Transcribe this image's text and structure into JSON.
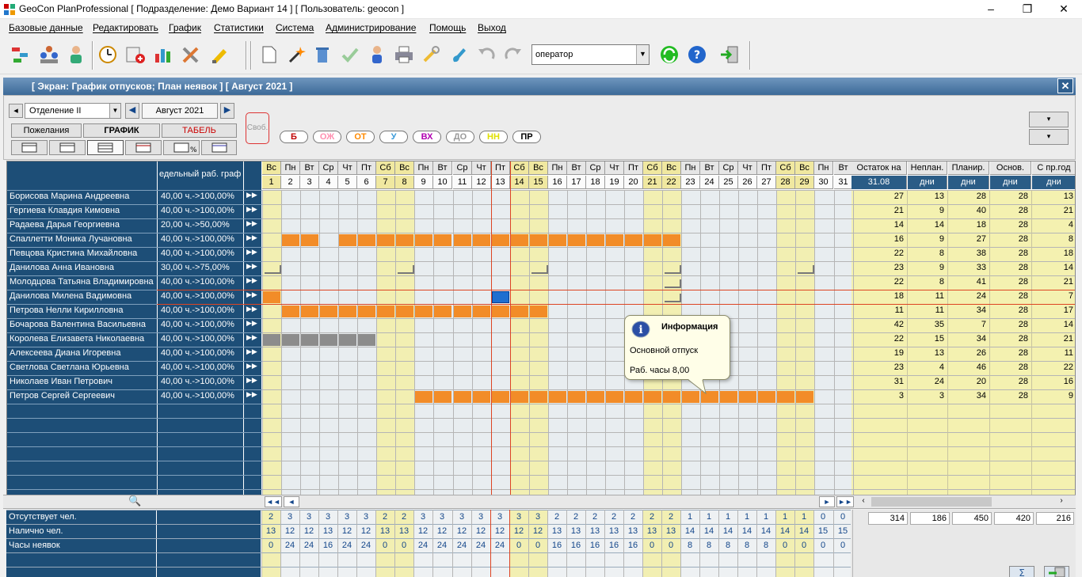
{
  "title": "GeoCon PlanProfessional [ Подразделение: Демо Вариант 14 ] [ Пользователь: geocon ]",
  "menu": [
    "Базовые данные",
    "Редактировать",
    "График",
    "Статистики",
    "Система",
    "Администрирование",
    "Помощь",
    "Выход"
  ],
  "toolbar": {
    "operator": "оператор"
  },
  "window_title": "[ Экран: График отпусков; План неявок ] [ Август 2021 ]",
  "controls": {
    "department": "Отделение II",
    "month": "Август 2021",
    "tabs": [
      "Пожелания",
      "ГРАФИК",
      "ТАБЕЛЬ"
    ],
    "free_label": "Своб.",
    "legend": [
      {
        "code": "Б",
        "color": "#c00000"
      },
      {
        "code": "ОЖ",
        "color": "#ff8fb0"
      },
      {
        "code": "ОТ",
        "color": "#ff8a00"
      },
      {
        "code": "У",
        "color": "#3a9ad9"
      },
      {
        "code": "ВХ",
        "color": "#b000b0"
      },
      {
        "code": "ДО",
        "color": "#9a9a9a"
      },
      {
        "code": "НН",
        "color": "#e0e000"
      },
      {
        "code": "ПР",
        "color": "#000000"
      }
    ]
  },
  "grid": {
    "norm_header": "едельный раб. графи",
    "weekdays": [
      "Вс",
      "Пн",
      "Вт",
      "Ср",
      "Чт",
      "Пт",
      "Сб",
      "Вс",
      "Пн",
      "Вт",
      "Ср",
      "Чт",
      "Пт",
      "Сб",
      "Вс",
      "Пн",
      "Вт",
      "Ср",
      "Чт",
      "Пт",
      "Сб",
      "Вс",
      "Пн",
      "Вт",
      "Ср",
      "Чт",
      "Пт",
      "Сб",
      "Вс",
      "Пн",
      "Вт"
    ],
    "right_headers": [
      {
        "top": "Остаток на",
        "sub": "31.08"
      },
      {
        "top": "Неплан.",
        "sub": "дни"
      },
      {
        "top": "Планир.",
        "sub": "дни"
      },
      {
        "top": "Основ.",
        "sub": "дни"
      },
      {
        "top": "С пр.год",
        "sub": "дни"
      }
    ],
    "rows": [
      {
        "name": "Борисова Марина Андреевна",
        "norm": "40,00 ч.->100,00%",
        "vals": [
          "27",
          "13",
          "28",
          "28",
          "13"
        ]
      },
      {
        "name": "Гергиева Клавдия Кимовна",
        "norm": "40,00 ч.->100,00%",
        "vals": [
          "21",
          "9",
          "40",
          "28",
          "21"
        ]
      },
      {
        "name": "Радаева Дарья Георгиевна",
        "norm": "20,00 ч.->50,00%",
        "vals": [
          "14",
          "14",
          "18",
          "28",
          "4"
        ]
      },
      {
        "name": "Спаллетти Моника Лучановна",
        "norm": "40,00 ч.->100,00%",
        "vals": [
          "16",
          "9",
          "27",
          "28",
          "8"
        ]
      },
      {
        "name": "Певцова Кристина Михайловна",
        "norm": "40,00 ч.->100,00%",
        "vals": [
          "22",
          "8",
          "38",
          "28",
          "18"
        ]
      },
      {
        "name": "Данилова Анна Ивановна",
        "norm": "30,00 ч.->75,00%",
        "vals": [
          "23",
          "9",
          "33",
          "28",
          "14"
        ]
      },
      {
        "name": "Молодцова Татьяна Владимировна",
        "norm": "40,00 ч.->100,00%",
        "vals": [
          "22",
          "8",
          "41",
          "28",
          "21"
        ]
      },
      {
        "name": "Данилова Милена Вадимовна",
        "norm": "40,00 ч.->100,00%",
        "vals": [
          "18",
          "11",
          "24",
          "28",
          "7"
        ]
      },
      {
        "name": "Петрова Нелли Кирилловна",
        "norm": "40,00 ч.->100,00%",
        "vals": [
          "11",
          "11",
          "34",
          "28",
          "17"
        ]
      },
      {
        "name": "Бочарова Валентина Васильевна",
        "norm": "40,00 ч.->100,00%",
        "vals": [
          "42",
          "35",
          "7",
          "28",
          "14"
        ]
      },
      {
        "name": "Королева Елизавета Николаевна",
        "norm": "40,00 ч.->100,00%",
        "vals": [
          "22",
          "15",
          "34",
          "28",
          "21"
        ]
      },
      {
        "name": "Алексеева Диана Игоревна",
        "norm": "40,00 ч.->100,00%",
        "vals": [
          "19",
          "13",
          "26",
          "28",
          "11"
        ]
      },
      {
        "name": "Светлова Светлана Юрьевна",
        "norm": "40,00 ч.->100,00%",
        "vals": [
          "23",
          "4",
          "46",
          "28",
          "22"
        ]
      },
      {
        "name": "Николаев Иван Петрович",
        "norm": "40,00 ч.->100,00%",
        "vals": [
          "31",
          "24",
          "20",
          "28",
          "16"
        ]
      },
      {
        "name": "Петров Сергей Сергеевич",
        "norm": "40,00 ч.->100,00%",
        "vals": [
          "3",
          "3",
          "34",
          "28",
          "9"
        ]
      }
    ]
  },
  "summary": {
    "rows": [
      {
        "label": "Отсутствует чел.",
        "vals": [
          "2",
          "3",
          "3",
          "3",
          "3",
          "3",
          "2",
          "2",
          "3",
          "3",
          "3",
          "3",
          "3",
          "3",
          "3",
          "2",
          "2",
          "2",
          "2",
          "2",
          "2",
          "2",
          "1",
          "1",
          "1",
          "1",
          "1",
          "1",
          "1",
          "0",
          "0"
        ]
      },
      {
        "label": "Налично чел.",
        "vals": [
          "13",
          "12",
          "12",
          "13",
          "12",
          "12",
          "13",
          "13",
          "12",
          "12",
          "12",
          "12",
          "12",
          "12",
          "12",
          "13",
          "13",
          "13",
          "13",
          "13",
          "13",
          "13",
          "14",
          "14",
          "14",
          "14",
          "14",
          "14",
          "14",
          "15",
          "15"
        ]
      },
      {
        "label": "Часы неявок",
        "vals": [
          "0",
          "24",
          "24",
          "16",
          "24",
          "24",
          "0",
          "0",
          "24",
          "24",
          "24",
          "24",
          "24",
          "0",
          "0",
          "16",
          "16",
          "16",
          "16",
          "16",
          "0",
          "0",
          "8",
          "8",
          "8",
          "8",
          "8",
          "0",
          "0",
          "0",
          "0"
        ]
      }
    ],
    "totals": [
      "314",
      "186",
      "450",
      "420",
      "216"
    ]
  },
  "tooltip": {
    "title": "Информация",
    "line1": "Основной отпуск",
    "line2": "Раб. часы 8,00"
  }
}
